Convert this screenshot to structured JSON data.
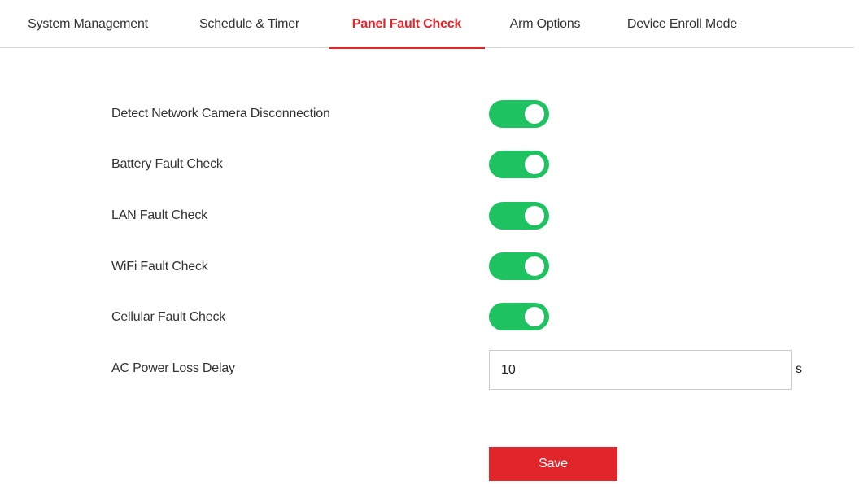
{
  "tabs": [
    {
      "label": "System Management"
    },
    {
      "label": "Schedule & Timer"
    },
    {
      "label": "Panel Fault Check",
      "active": true
    },
    {
      "label": "Arm Options"
    },
    {
      "label": "Device Enroll Mode"
    }
  ],
  "form": {
    "toggles": [
      {
        "label": "Detect Network Camera Disconnection",
        "enabled": true
      },
      {
        "label": "Battery Fault Check",
        "enabled": true
      },
      {
        "label": "LAN Fault Check",
        "enabled": true
      },
      {
        "label": "WiFi Fault Check",
        "enabled": true
      },
      {
        "label": "Cellular Fault Check",
        "enabled": true
      }
    ],
    "ac_power_loss_delay": {
      "label": "AC Power Loss Delay",
      "value": "10",
      "unit": "s"
    },
    "save_label": "Save"
  },
  "colors": {
    "accent": "#e0262a",
    "toggle_on": "#1fc260"
  }
}
